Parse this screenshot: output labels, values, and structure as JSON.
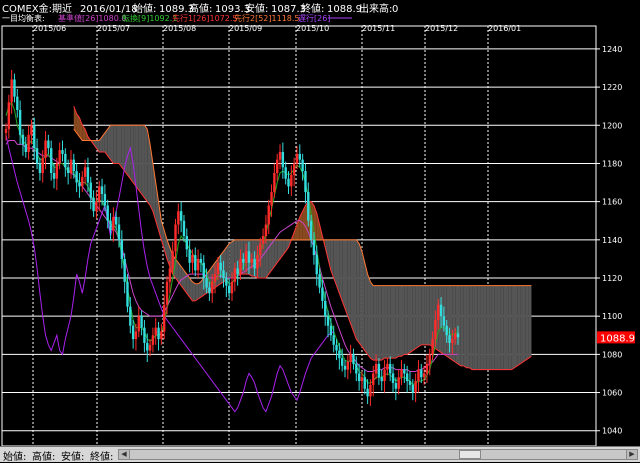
{
  "header": {
    "symbol": "COMEX金:期近",
    "date": "2016/01/18",
    "open_label": "始値:",
    "open": "1089.3",
    "high_label": "高値:",
    "high": "1093.3",
    "low_label": "安値:",
    "low": "1087.3",
    "close_label": "終値:",
    "close": "1088.9",
    "volume_label": "出来高:",
    "volume": "0"
  },
  "legend": {
    "title": "一目均衡表:",
    "items": [
      {
        "text": "基準値[26]1080.0",
        "color": "#cc44cc"
      },
      {
        "text": "転換[9]1092.1",
        "color": "#33cc33"
      },
      {
        "text": "先行1[26]1072.5",
        "color": "#ff3333"
      },
      {
        "text": "先行2[52]1118.5",
        "color": "#ff7733"
      },
      {
        "text": "遅行[26]",
        "color": "#aa44ff"
      }
    ]
  },
  "bottom": {
    "labels": [
      "始値:",
      "高値:",
      "安値:",
      "終値:"
    ]
  },
  "colors": {
    "up_candle": "#ff2a2a",
    "down_candle": "#33dddd",
    "kijun": "#cc44cc",
    "tenkan": "#22aa22",
    "senkou1": "#ff3333",
    "senkou2": "#ff7733",
    "chikou": "#aa22ee",
    "cloud_bull": "#8a4a20",
    "cloud_bear": "#555555",
    "grid": "#ffffff",
    "price_tag_bg": "#ff0000"
  },
  "chart_data": {
    "type": "candlestick",
    "y_ticks": [
      1040,
      1060,
      1080,
      1100,
      1120,
      1140,
      1160,
      1180,
      1200,
      1220,
      1240
    ],
    "ylim": [
      1032,
      1252
    ],
    "x_labels": [
      "2015/06",
      "2015/07",
      "2015/08",
      "2015/09",
      "2015/10",
      "2015/11",
      "2015/12",
      "2016/01"
    ],
    "last_price": "1088.9",
    "candles": [
      1198,
      1212,
      1224,
      1215,
      1208,
      1195,
      1190,
      1186,
      1195,
      1200,
      1188,
      1180,
      1175,
      1183,
      1192,
      1188,
      1175,
      1172,
      1180,
      1187,
      1185,
      1178,
      1175,
      1182,
      1176,
      1170,
      1168,
      1173,
      1178,
      1170,
      1162,
      1155,
      1160,
      1168,
      1164,
      1158,
      1150,
      1145,
      1152,
      1148,
      1140,
      1130,
      1118,
      1105,
      1095,
      1088,
      1092,
      1100,
      1094,
      1086,
      1082,
      1085,
      1090,
      1094,
      1088,
      1092,
      1106,
      1118,
      1125,
      1134,
      1148,
      1155,
      1150,
      1142,
      1135,
      1128,
      1132,
      1124,
      1130,
      1128,
      1120,
      1115,
      1112,
      1118,
      1122,
      1128,
      1124,
      1120,
      1116,
      1112,
      1118,
      1125,
      1122,
      1130,
      1128,
      1134,
      1128,
      1130,
      1125,
      1132,
      1138,
      1142,
      1148,
      1158,
      1165,
      1175,
      1182,
      1186,
      1178,
      1172,
      1168,
      1174,
      1180,
      1185,
      1182,
      1176,
      1165,
      1150,
      1140,
      1132,
      1122,
      1115,
      1108,
      1100,
      1095,
      1090,
      1085,
      1082,
      1078,
      1074,
      1072,
      1076,
      1080,
      1075,
      1070,
      1066,
      1068,
      1062,
      1058,
      1064,
      1070,
      1075,
      1068,
      1066,
      1072,
      1075,
      1070,
      1065,
      1062,
      1068,
      1072,
      1070,
      1066,
      1064,
      1060,
      1066,
      1072,
      1068,
      1070,
      1075,
      1080,
      1088,
      1098,
      1106,
      1100,
      1095,
      1090,
      1086,
      1088,
      1091,
      1089
    ],
    "tenkan": [
      1205,
      1210,
      1212,
      1208,
      1200,
      1196,
      1192,
      1190,
      1190,
      1192,
      1190,
      1185,
      1182,
      1182,
      1184,
      1185,
      1182,
      1178,
      1178,
      1180,
      1180,
      1178,
      1176,
      1176,
      1175,
      1172,
      1170,
      1170,
      1170,
      1168,
      1164,
      1160,
      1160,
      1161,
      1160,
      1157,
      1152,
      1148,
      1148,
      1146,
      1140,
      1132,
      1124,
      1115,
      1106,
      1098,
      1094,
      1094,
      1094,
      1092,
      1088,
      1087,
      1088,
      1090,
      1090,
      1091,
      1097,
      1104,
      1111,
      1120,
      1128,
      1138,
      1142,
      1140,
      1138,
      1135,
      1133,
      1130,
      1129,
      1128,
      1126,
      1122,
      1118,
      1117,
      1118,
      1121,
      1122,
      1121,
      1119,
      1117,
      1117,
      1120,
      1121,
      1124,
      1126,
      1128,
      1129,
      1129,
      1128,
      1130,
      1134,
      1138,
      1143,
      1150,
      1156,
      1163,
      1170,
      1175,
      1176,
      1175,
      1174,
      1175,
      1177,
      1179,
      1178,
      1175,
      1170,
      1162,
      1154,
      1145,
      1135,
      1125,
      1116,
      1108,
      1102,
      1097,
      1092,
      1088,
      1084,
      1080,
      1077,
      1076,
      1077,
      1076,
      1074,
      1071,
      1070,
      1068,
      1065,
      1065,
      1066,
      1068,
      1068,
      1068,
      1069,
      1070,
      1069,
      1068,
      1066,
      1067,
      1068,
      1068,
      1067,
      1066,
      1064,
      1065,
      1066,
      1066,
      1067,
      1069,
      1072,
      1078,
      1085,
      1092,
      1094,
      1094,
      1093,
      1091,
      1090,
      1091,
      1092
    ],
    "kijun": [
      1190,
      1192,
      1192,
      1192,
      1190,
      1190,
      1190,
      1188,
      1188,
      1188,
      1187,
      1186,
      1185,
      1184,
      1184,
      1184,
      1183,
      1182,
      1181,
      1180,
      1180,
      1178,
      1176,
      1175,
      1174,
      1172,
      1170,
      1168,
      1166,
      1164,
      1162,
      1160,
      1158,
      1156,
      1154,
      1152,
      1150,
      1148,
      1146,
      1144,
      1140,
      1136,
      1130,
      1124,
      1118,
      1112,
      1108,
      1105,
      1103,
      1102,
      1101,
      1100,
      1100,
      1100,
      1100,
      1100,
      1102,
      1105,
      1108,
      1111,
      1114,
      1117,
      1119,
      1120,
      1121,
      1122,
      1122,
      1122,
      1122,
      1122,
      1122,
      1121,
      1120,
      1120,
      1120,
      1121,
      1121,
      1121,
      1120,
      1120,
      1120,
      1120,
      1121,
      1122,
      1123,
      1124,
      1125,
      1126,
      1127,
      1128,
      1130,
      1132,
      1134,
      1136,
      1138,
      1140,
      1142,
      1144,
      1145,
      1146,
      1147,
      1148,
      1149,
      1150,
      1150,
      1149,
      1147,
      1144,
      1140,
      1136,
      1131,
      1126,
      1120,
      1115,
      1110,
      1105,
      1101,
      1097,
      1093,
      1089,
      1085,
      1082,
      1080,
      1078,
      1076,
      1074,
      1073,
      1072,
      1071,
      1071,
      1071,
      1072,
      1072,
      1072,
      1073,
      1073,
      1073,
      1073,
      1072,
      1072,
      1072,
      1072,
      1072,
      1071,
      1071,
      1071,
      1072,
      1072,
      1073,
      1074,
      1075,
      1076,
      1078,
      1080,
      1080,
      1080,
      1080,
      1080,
      1080,
      1080,
      1080
    ],
    "senkou1": [
      1210,
      1206,
      1204,
      1200,
      1198,
      1194,
      1192,
      1190,
      1188,
      1186,
      1186,
      1186,
      1184,
      1182,
      1180,
      1180,
      1180,
      1178,
      1176,
      1174,
      1172,
      1170,
      1168,
      1166,
      1164,
      1162,
      1160,
      1158,
      1155,
      1150,
      1145,
      1140,
      1135,
      1130,
      1126,
      1122,
      1120,
      1118,
      1116,
      1114,
      1112,
      1110,
      1108,
      1108,
      1109,
      1110,
      1111,
      1112,
      1113,
      1114,
      1115,
      1116,
      1117,
      1118,
      1119,
      1120,
      1120,
      1120,
      1121,
      1122,
      1122,
      1122,
      1122,
      1121,
      1121,
      1120,
      1120,
      1120,
      1120,
      1122,
      1124,
      1126,
      1128,
      1130,
      1132,
      1134,
      1136,
      1140,
      1144,
      1148,
      1152,
      1155,
      1158,
      1160,
      1160,
      1158,
      1154,
      1148,
      1142,
      1136,
      1130,
      1124,
      1120,
      1116,
      1112,
      1108,
      1104,
      1100,
      1096,
      1092,
      1088,
      1086,
      1084,
      1082,
      1080,
      1078,
      1077,
      1077,
      1077,
      1077,
      1078,
      1078,
      1078,
      1078,
      1078,
      1079,
      1079,
      1080,
      1080,
      1081,
      1082,
      1083,
      1084,
      1085,
      1085,
      1085,
      1085,
      1084,
      1083,
      1082,
      1081,
      1080,
      1079,
      1078,
      1077,
      1076,
      1075,
      1074,
      1074,
      1073,
      1073,
      1072,
      1072,
      1072,
      1072,
      1072,
      1072,
      1072,
      1072,
      1072,
      1072,
      1072,
      1072,
      1072,
      1072,
      1072,
      1073,
      1074,
      1075,
      1076,
      1077,
      1078,
      1079
    ],
    "senkou2": [
      1198,
      1196,
      1194,
      1192,
      1192,
      1192,
      1192,
      1192,
      1192,
      1192,
      1194,
      1196,
      1198,
      1200,
      1200,
      1200,
      1200,
      1200,
      1200,
      1200,
      1200,
      1200,
      1200,
      1200,
      1200,
      1200,
      1198,
      1190,
      1180,
      1170,
      1160,
      1150,
      1145,
      1140,
      1136,
      1132,
      1130,
      1128,
      1126,
      1124,
      1122,
      1120,
      1118,
      1117,
      1117,
      1118,
      1120,
      1122,
      1124,
      1126,
      1128,
      1130,
      1132,
      1134,
      1136,
      1138,
      1139,
      1140,
      1140,
      1140,
      1140,
      1140,
      1140,
      1140,
      1140,
      1140,
      1140,
      1140,
      1140,
      1140,
      1140,
      1140,
      1140,
      1140,
      1140,
      1140,
      1140,
      1140,
      1140,
      1140,
      1140,
      1140,
      1140,
      1140,
      1140,
      1140,
      1140,
      1140,
      1140,
      1140,
      1140,
      1140,
      1140,
      1140,
      1140,
      1140,
      1140,
      1140,
      1140,
      1140,
      1140,
      1138,
      1134,
      1128,
      1122,
      1118,
      1116,
      1116,
      1116,
      1116,
      1116,
      1116,
      1116,
      1116,
      1116,
      1116,
      1116,
      1116,
      1116,
      1116,
      1116,
      1116,
      1116,
      1116,
      1116,
      1116,
      1116,
      1116,
      1116,
      1116,
      1116,
      1116,
      1116,
      1116,
      1116,
      1116,
      1116,
      1116,
      1116,
      1116,
      1116,
      1116,
      1116,
      1116,
      1116,
      1116,
      1116,
      1116,
      1116,
      1116,
      1116,
      1116,
      1116,
      1116,
      1116,
      1116,
      1116,
      1116,
      1116,
      1116,
      1116,
      1116,
      1116
    ],
    "chikou": [
      1195,
      1188,
      1182,
      1176,
      1170,
      1165,
      1160,
      1155,
      1150,
      1144,
      1136,
      1125,
      1112,
      1100,
      1090,
      1085,
      1082,
      1086,
      1090,
      1082,
      1080,
      1088,
      1094,
      1100,
      1110,
      1122,
      1118,
      1112,
      1120,
      1130,
      1138,
      1142,
      1146,
      1150,
      1154,
      1158,
      1150,
      1142,
      1148,
      1155,
      1162,
      1170,
      1178,
      1184,
      1188,
      1180,
      1168,
      1156,
      1144,
      1134,
      1126,
      1120,
      1116,
      1112,
      1108,
      1104,
      1100,
      1098,
      1096,
      1094,
      1092,
      1090,
      1088,
      1086,
      1084,
      1082,
      1080,
      1078,
      1076,
      1074,
      1072,
      1070,
      1068,
      1066,
      1064,
      1062,
      1060,
      1058,
      1056,
      1054,
      1052,
      1050,
      1052,
      1056,
      1060,
      1066,
      1070,
      1068,
      1065,
      1060,
      1056,
      1052,
      1050,
      1054,
      1058,
      1064,
      1070,
      1074,
      1072,
      1068,
      1064,
      1060,
      1058,
      1056,
      1060,
      1065,
      1070,
      1074,
      1078,
      1080,
      1082,
      1084,
      1086,
      1088,
      1090,
      1091,
      1092
    ]
  }
}
